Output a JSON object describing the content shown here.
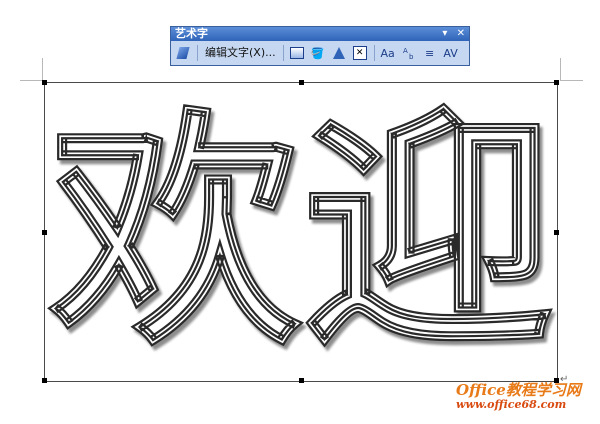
{
  "toolbar": {
    "title": "艺术字",
    "menu_glyph": "▾",
    "close_glyph": "✕",
    "edit_text_label": "编辑文字(X)...",
    "spacing_glyph": "Aa",
    "align_glyph": "≡",
    "char_spacing_glyph": "AV"
  },
  "wordart": {
    "text": "欢迎"
  },
  "paragraph_mark": "↵",
  "watermark": {
    "title": "Office教程学习网",
    "url": "www.office68.com"
  }
}
